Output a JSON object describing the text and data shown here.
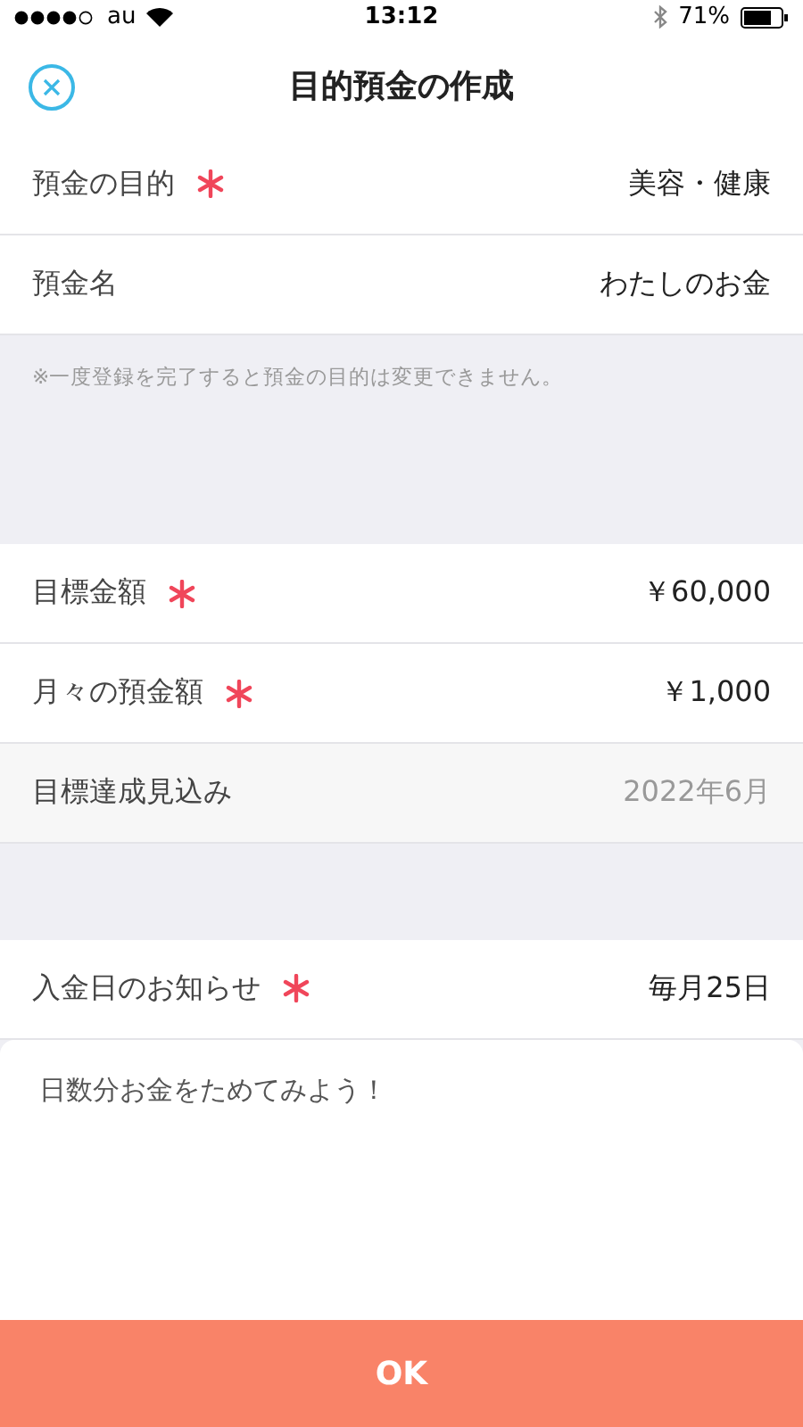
{
  "status_bar": {
    "carrier": "au",
    "time": "13:12",
    "battery": "71%"
  },
  "nav": {
    "title": "目的預金の作成"
  },
  "sections": [
    {
      "rows": [
        {
          "label": "預金の目的",
          "required": true,
          "value": "美容・健康",
          "readonly": false
        },
        {
          "label": "預金名",
          "required": false,
          "value": "わたしのお金",
          "readonly": false
        }
      ],
      "note": "※一度登録を完了すると預金の目的は変更できません。"
    },
    {
      "rows": [
        {
          "label": "目標金額",
          "required": true,
          "value": "￥60,000",
          "readonly": false
        },
        {
          "label": "月々の預金額",
          "required": true,
          "value": "￥1,000",
          "readonly": false
        },
        {
          "label": "目標達成見込み",
          "required": false,
          "value": "2022年6月",
          "readonly": true
        }
      ]
    },
    {
      "rows": [
        {
          "label": "入金日のお知らせ",
          "required": true,
          "value": "毎月25日",
          "readonly": false
        }
      ]
    }
  ],
  "card": {
    "text": "日数分お金をためてみよう！"
  },
  "ok_button": {
    "label": "OK"
  }
}
